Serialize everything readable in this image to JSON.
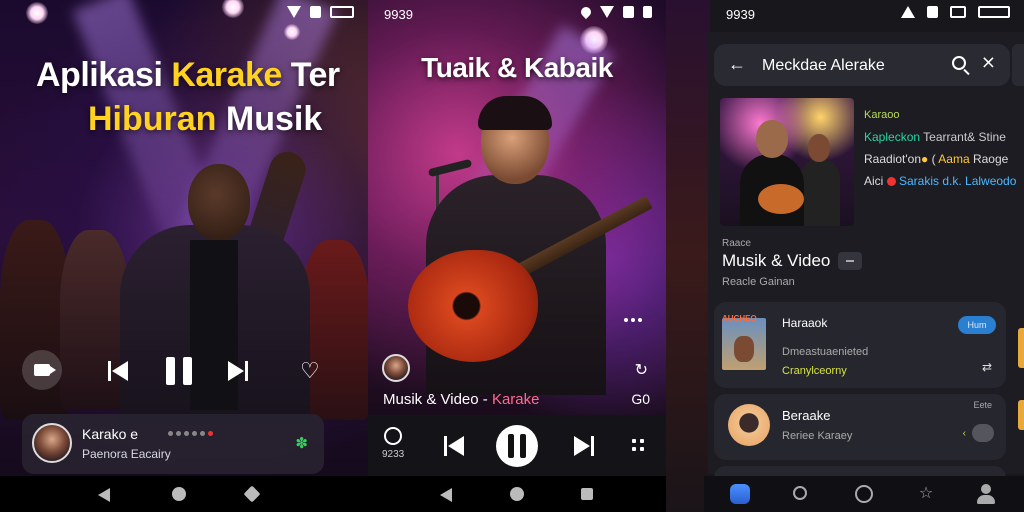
{
  "screen1": {
    "headline_prefix": "Aplikasi ",
    "headline_accent": "Karake",
    "headline_suffix": " Ter",
    "subline_accent": "Hiburan",
    "subline_rest": " Musik",
    "now_playing": {
      "title": "Karako e",
      "subtitle": "Paenora Eacairy"
    },
    "colors": {
      "accent": "#ffd21f",
      "live_dot": "#e33333",
      "settings": "#2fd45a"
    }
  },
  "screen2": {
    "status_time": "9939",
    "title": "Tuaik & Kabaik",
    "caption_main": "Musik & Video",
    "caption_sep": " - ",
    "caption_sub": "Karake",
    "caption_right": "G0",
    "timer_label": "9233"
  },
  "screen3": {
    "status_time": "9939",
    "search_title": "Meckdae Alerake",
    "featured": {
      "tag": "Karaoo",
      "line2_a": "Kapleckon",
      "line2_b": " Tearrant& Stine",
      "line3_a": "Raadiot'on",
      "line3_b": " ( ",
      "line3_c": "Aama",
      "line3_d": "  Raoge",
      "line4_a": "Aici ",
      "line4_b": " Sarakis d.k. Lalweodo"
    },
    "section": {
      "kicker": "Raace",
      "title": "Musik & Video",
      "subtitle": "Reacle Gainan"
    },
    "cards": [
      {
        "tag": "AUCHEO",
        "title": "Haraaok",
        "line2": "Dmeastuaenieted",
        "line3": "Cranylceorny",
        "pill": "Hum"
      },
      {
        "title": "Beraake",
        "subtitle": "Reriee Karaey",
        "mini": "Eete"
      }
    ],
    "colors": {
      "pill": "#2a7fd0",
      "highlight": "#d6e340",
      "tab_active": "#4a90ff"
    }
  }
}
